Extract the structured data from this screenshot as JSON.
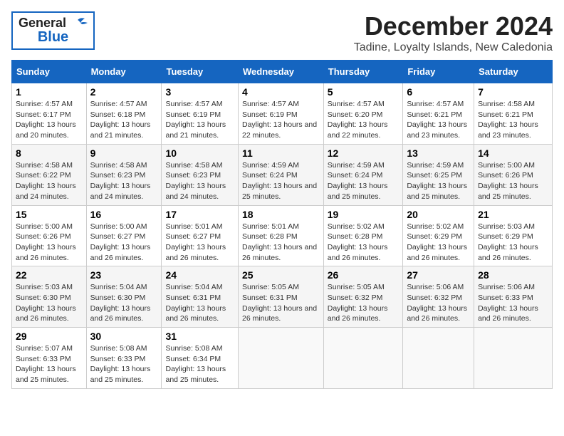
{
  "header": {
    "logo_general": "General",
    "logo_blue": "Blue",
    "main_title": "December 2024",
    "subtitle": "Tadine, Loyalty Islands, New Caledonia"
  },
  "columns": [
    "Sunday",
    "Monday",
    "Tuesday",
    "Wednesday",
    "Thursday",
    "Friday",
    "Saturday"
  ],
  "weeks": [
    [
      {
        "day": "1",
        "sunrise": "Sunrise: 4:57 AM",
        "sunset": "Sunset: 6:17 PM",
        "daylight": "Daylight: 13 hours and 20 minutes."
      },
      {
        "day": "2",
        "sunrise": "Sunrise: 4:57 AM",
        "sunset": "Sunset: 6:18 PM",
        "daylight": "Daylight: 13 hours and 21 minutes."
      },
      {
        "day": "3",
        "sunrise": "Sunrise: 4:57 AM",
        "sunset": "Sunset: 6:19 PM",
        "daylight": "Daylight: 13 hours and 21 minutes."
      },
      {
        "day": "4",
        "sunrise": "Sunrise: 4:57 AM",
        "sunset": "Sunset: 6:19 PM",
        "daylight": "Daylight: 13 hours and 22 minutes."
      },
      {
        "day": "5",
        "sunrise": "Sunrise: 4:57 AM",
        "sunset": "Sunset: 6:20 PM",
        "daylight": "Daylight: 13 hours and 22 minutes."
      },
      {
        "day": "6",
        "sunrise": "Sunrise: 4:57 AM",
        "sunset": "Sunset: 6:21 PM",
        "daylight": "Daylight: 13 hours and 23 minutes."
      },
      {
        "day": "7",
        "sunrise": "Sunrise: 4:58 AM",
        "sunset": "Sunset: 6:21 PM",
        "daylight": "Daylight: 13 hours and 23 minutes."
      }
    ],
    [
      {
        "day": "8",
        "sunrise": "Sunrise: 4:58 AM",
        "sunset": "Sunset: 6:22 PM",
        "daylight": "Daylight: 13 hours and 24 minutes."
      },
      {
        "day": "9",
        "sunrise": "Sunrise: 4:58 AM",
        "sunset": "Sunset: 6:23 PM",
        "daylight": "Daylight: 13 hours and 24 minutes."
      },
      {
        "day": "10",
        "sunrise": "Sunrise: 4:58 AM",
        "sunset": "Sunset: 6:23 PM",
        "daylight": "Daylight: 13 hours and 24 minutes."
      },
      {
        "day": "11",
        "sunrise": "Sunrise: 4:59 AM",
        "sunset": "Sunset: 6:24 PM",
        "daylight": "Daylight: 13 hours and 25 minutes."
      },
      {
        "day": "12",
        "sunrise": "Sunrise: 4:59 AM",
        "sunset": "Sunset: 6:24 PM",
        "daylight": "Daylight: 13 hours and 25 minutes."
      },
      {
        "day": "13",
        "sunrise": "Sunrise: 4:59 AM",
        "sunset": "Sunset: 6:25 PM",
        "daylight": "Daylight: 13 hours and 25 minutes."
      },
      {
        "day": "14",
        "sunrise": "Sunrise: 5:00 AM",
        "sunset": "Sunset: 6:26 PM",
        "daylight": "Daylight: 13 hours and 25 minutes."
      }
    ],
    [
      {
        "day": "15",
        "sunrise": "Sunrise: 5:00 AM",
        "sunset": "Sunset: 6:26 PM",
        "daylight": "Daylight: 13 hours and 26 minutes."
      },
      {
        "day": "16",
        "sunrise": "Sunrise: 5:00 AM",
        "sunset": "Sunset: 6:27 PM",
        "daylight": "Daylight: 13 hours and 26 minutes."
      },
      {
        "day": "17",
        "sunrise": "Sunrise: 5:01 AM",
        "sunset": "Sunset: 6:27 PM",
        "daylight": "Daylight: 13 hours and 26 minutes."
      },
      {
        "day": "18",
        "sunrise": "Sunrise: 5:01 AM",
        "sunset": "Sunset: 6:28 PM",
        "daylight": "Daylight: 13 hours and 26 minutes."
      },
      {
        "day": "19",
        "sunrise": "Sunrise: 5:02 AM",
        "sunset": "Sunset: 6:28 PM",
        "daylight": "Daylight: 13 hours and 26 minutes."
      },
      {
        "day": "20",
        "sunrise": "Sunrise: 5:02 AM",
        "sunset": "Sunset: 6:29 PM",
        "daylight": "Daylight: 13 hours and 26 minutes."
      },
      {
        "day": "21",
        "sunrise": "Sunrise: 5:03 AM",
        "sunset": "Sunset: 6:29 PM",
        "daylight": "Daylight: 13 hours and 26 minutes."
      }
    ],
    [
      {
        "day": "22",
        "sunrise": "Sunrise: 5:03 AM",
        "sunset": "Sunset: 6:30 PM",
        "daylight": "Daylight: 13 hours and 26 minutes."
      },
      {
        "day": "23",
        "sunrise": "Sunrise: 5:04 AM",
        "sunset": "Sunset: 6:30 PM",
        "daylight": "Daylight: 13 hours and 26 minutes."
      },
      {
        "day": "24",
        "sunrise": "Sunrise: 5:04 AM",
        "sunset": "Sunset: 6:31 PM",
        "daylight": "Daylight: 13 hours and 26 minutes."
      },
      {
        "day": "25",
        "sunrise": "Sunrise: 5:05 AM",
        "sunset": "Sunset: 6:31 PM",
        "daylight": "Daylight: 13 hours and 26 minutes."
      },
      {
        "day": "26",
        "sunrise": "Sunrise: 5:05 AM",
        "sunset": "Sunset: 6:32 PM",
        "daylight": "Daylight: 13 hours and 26 minutes."
      },
      {
        "day": "27",
        "sunrise": "Sunrise: 5:06 AM",
        "sunset": "Sunset: 6:32 PM",
        "daylight": "Daylight: 13 hours and 26 minutes."
      },
      {
        "day": "28",
        "sunrise": "Sunrise: 5:06 AM",
        "sunset": "Sunset: 6:33 PM",
        "daylight": "Daylight: 13 hours and 26 minutes."
      }
    ],
    [
      {
        "day": "29",
        "sunrise": "Sunrise: 5:07 AM",
        "sunset": "Sunset: 6:33 PM",
        "daylight": "Daylight: 13 hours and 25 minutes."
      },
      {
        "day": "30",
        "sunrise": "Sunrise: 5:08 AM",
        "sunset": "Sunset: 6:33 PM",
        "daylight": "Daylight: 13 hours and 25 minutes."
      },
      {
        "day": "31",
        "sunrise": "Sunrise: 5:08 AM",
        "sunset": "Sunset: 6:34 PM",
        "daylight": "Daylight: 13 hours and 25 minutes."
      },
      null,
      null,
      null,
      null
    ]
  ]
}
